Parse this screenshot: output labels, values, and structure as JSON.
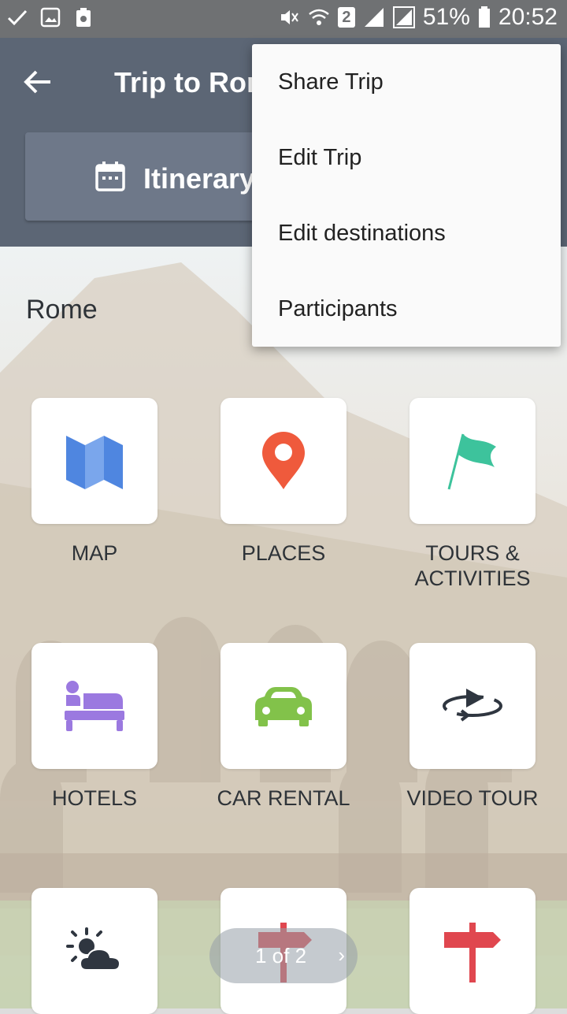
{
  "status_bar": {
    "battery": "51%",
    "time": "20:52",
    "sim": "2",
    "icons": [
      "check-icon",
      "image-icon",
      "recycle-icon",
      "mute-icon",
      "wifi-icon",
      "sim-icon",
      "signal-icon",
      "signal-icon",
      "battery-icon"
    ]
  },
  "appbar": {
    "title": "Trip to Rome",
    "itinerary_label": "Itinerary"
  },
  "content": {
    "city": "Rome",
    "tiles": [
      {
        "label": "MAP",
        "icon": "map-icon"
      },
      {
        "label": "PLACES",
        "icon": "location-pin-icon"
      },
      {
        "label": "TOURS &",
        "label2": "ACTIVITIES",
        "icon": "flag-icon"
      },
      {
        "label": "HOTELS",
        "icon": "bed-icon"
      },
      {
        "label": "CAR RENTAL",
        "icon": "car-icon"
      },
      {
        "label": "VIDEO TOUR",
        "icon": "video-360-icon"
      },
      {
        "label": "",
        "icon": "weather-icon"
      },
      {
        "label": "",
        "icon": "signpost-icon"
      },
      {
        "label": "",
        "icon": "signpost-icon"
      }
    ]
  },
  "pager": {
    "text": "1 of 2"
  },
  "menu": {
    "items": [
      "Share Trip",
      "Edit Trip",
      "Edit destinations",
      "Participants"
    ]
  },
  "colors": {
    "appbar": "#5c6675",
    "map_blue": "#4f86e0",
    "pin_red": "#ef5a3c",
    "flag_green": "#3dc39c",
    "hotel_purple": "#9b79e0",
    "car_green": "#82c24a",
    "sign_red": "#e0474f"
  }
}
